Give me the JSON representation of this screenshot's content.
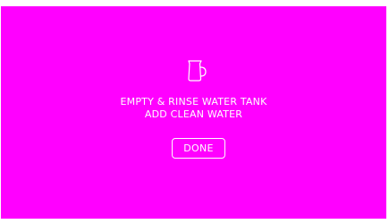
{
  "screen": {
    "background_color": "#ff00ff",
    "foreground_color": "#ffffff",
    "icon": "water-pitcher-icon",
    "message_line1": "EMPTY & RINSE WATER TANK",
    "message_line2": "ADD CLEAN WATER",
    "done_label": "DONE"
  }
}
